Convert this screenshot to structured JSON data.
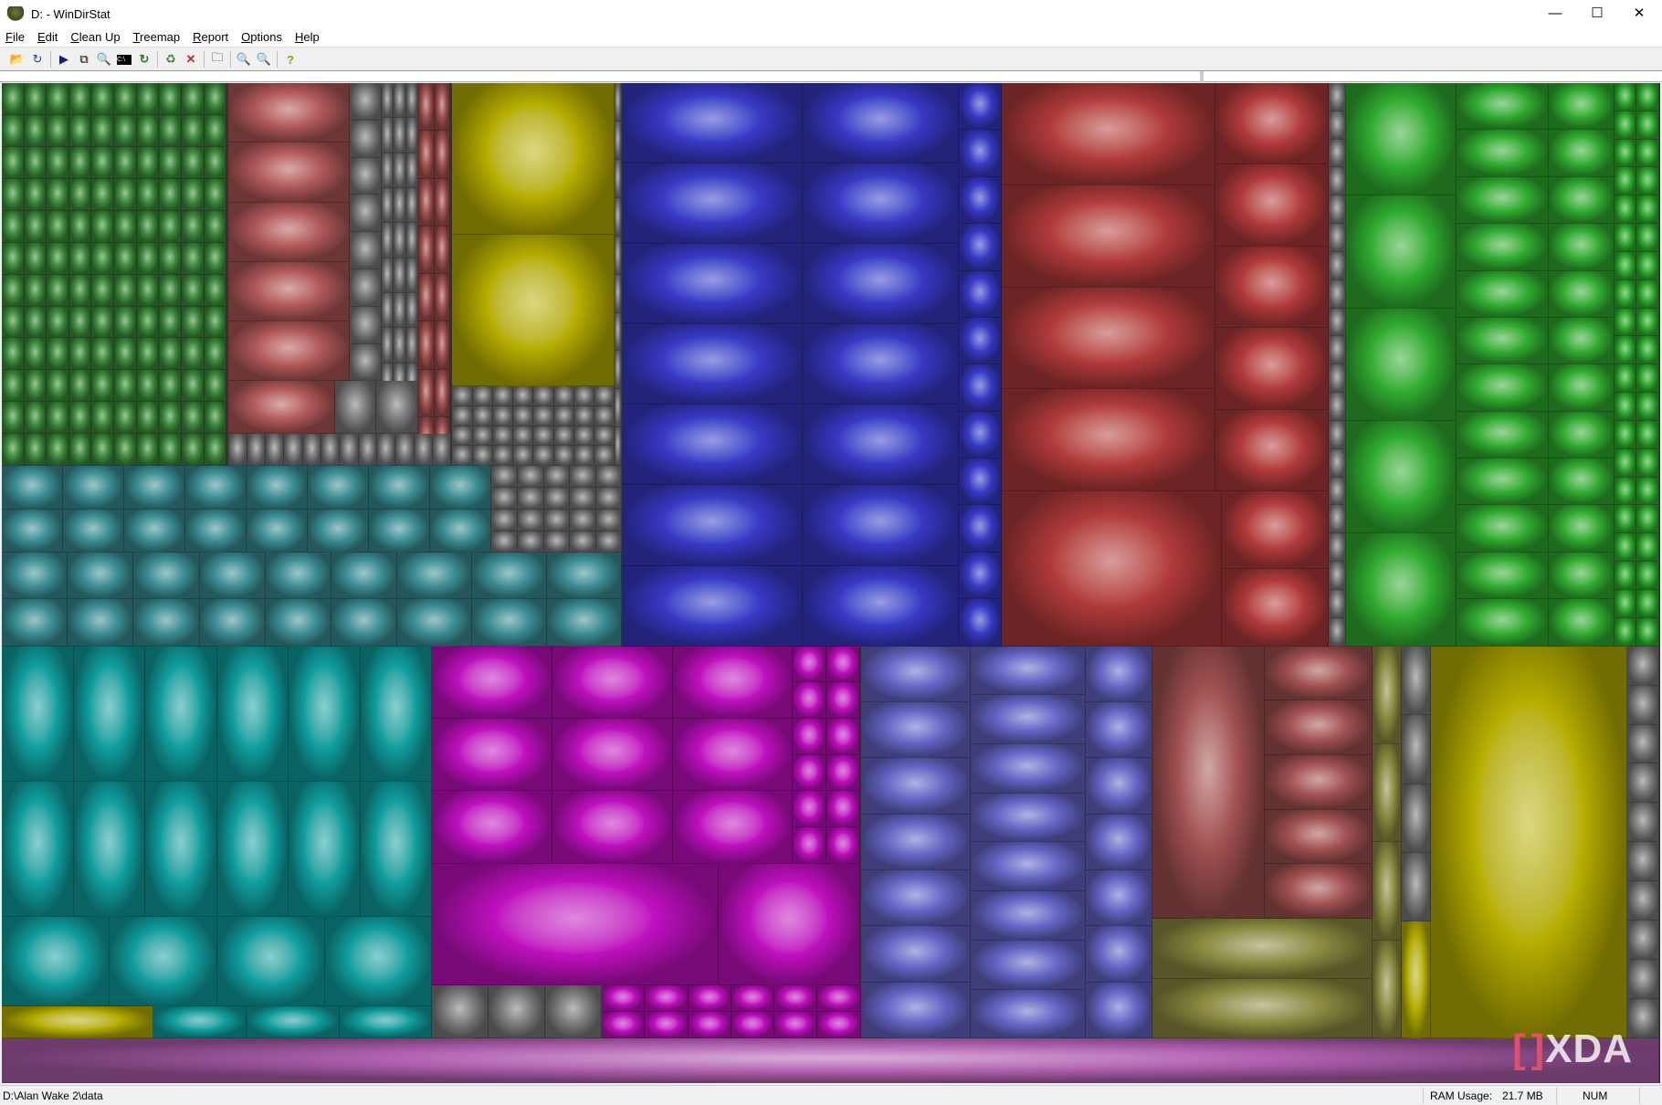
{
  "window": {
    "title": "D: - WinDirStat",
    "controls": [
      "minimize",
      "maximize",
      "close"
    ]
  },
  "menu": {
    "items": [
      "File",
      "Edit",
      "Clean Up",
      "Treemap",
      "Report",
      "Options",
      "Help"
    ]
  },
  "toolbar": {
    "icons": [
      "open-icon",
      "rescan-icon",
      "run-icon",
      "copy-path-icon",
      "explorer-icon",
      "command-prompt-icon",
      "refresh-icon",
      "recycle-bin-icon",
      "delete-icon",
      "new-folder-icon",
      "zoom-in-icon",
      "zoom-out-icon",
      "help-icon"
    ]
  },
  "treemap": {
    "palette": [
      "#3d8a3d",
      "#b05858",
      "#7a7a7a",
      "#b8b000",
      "#3a8e94",
      "#3838c4",
      "#b03a3a",
      "#30ac30",
      "#10a0a0",
      "#c010c0",
      "#6464c4",
      "#8a8a40",
      "#b060b0",
      "#a05050"
    ]
  },
  "watermark": "XDA",
  "status": {
    "path": "D:\\Alan Wake 2\\data",
    "ram_label": "RAM Usage:",
    "ram_value": "21.7 MB",
    "num": "NUM"
  }
}
